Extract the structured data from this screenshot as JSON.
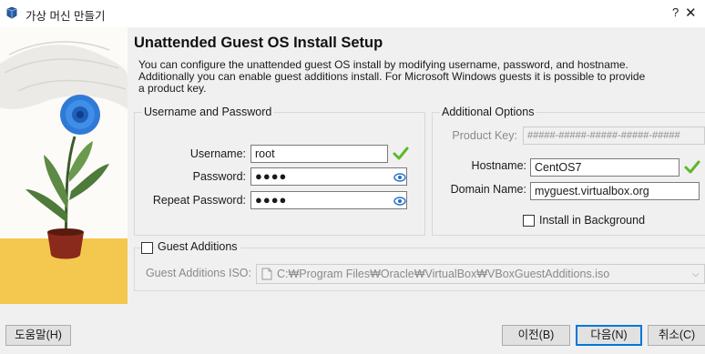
{
  "window": {
    "title": "가상 머신 만들기",
    "help_glyph": "?",
    "close_glyph": "✕"
  },
  "page": {
    "heading": "Unattended Guest OS Install Setup",
    "description": "You can configure the unattended guest OS install by modifying username, password, and hostname. Additionally you can enable guest additions install. For Microsoft Windows guests it is possible to provide a product key."
  },
  "user_group": {
    "title": "Username and Password",
    "username_label": "Username:",
    "username_value": "root",
    "password_label": "Password:",
    "password_value": "●●●●",
    "repeat_label": "Repeat Password:",
    "repeat_value": "●●●●"
  },
  "options_group": {
    "title": "Additional Options",
    "product_key_label": "Product Key:",
    "product_key_placeholder": "#####-#####-#####-#####-#####",
    "hostname_label": "Hostname:",
    "hostname_value": "CentOS7",
    "domain_label": "Domain Name:",
    "domain_value": "myguest.virtualbox.org",
    "install_bg_label": "Install in Background"
  },
  "guest_additions": {
    "checkbox_label": "Guest Additions",
    "iso_label": "Guest Additions ISO:",
    "iso_path": "C:₩Program Files₩Oracle₩VirtualBox₩VBoxGuestAdditions.iso"
  },
  "footer": {
    "help_button": "도움말(H)",
    "back_button": "이전(B)",
    "next_button": "다음(N)",
    "cancel_button": "취소(C)"
  },
  "colors": {
    "accent": "#0078d7",
    "valid_check": "#5fb82a",
    "eye": "#1e6fc7"
  }
}
